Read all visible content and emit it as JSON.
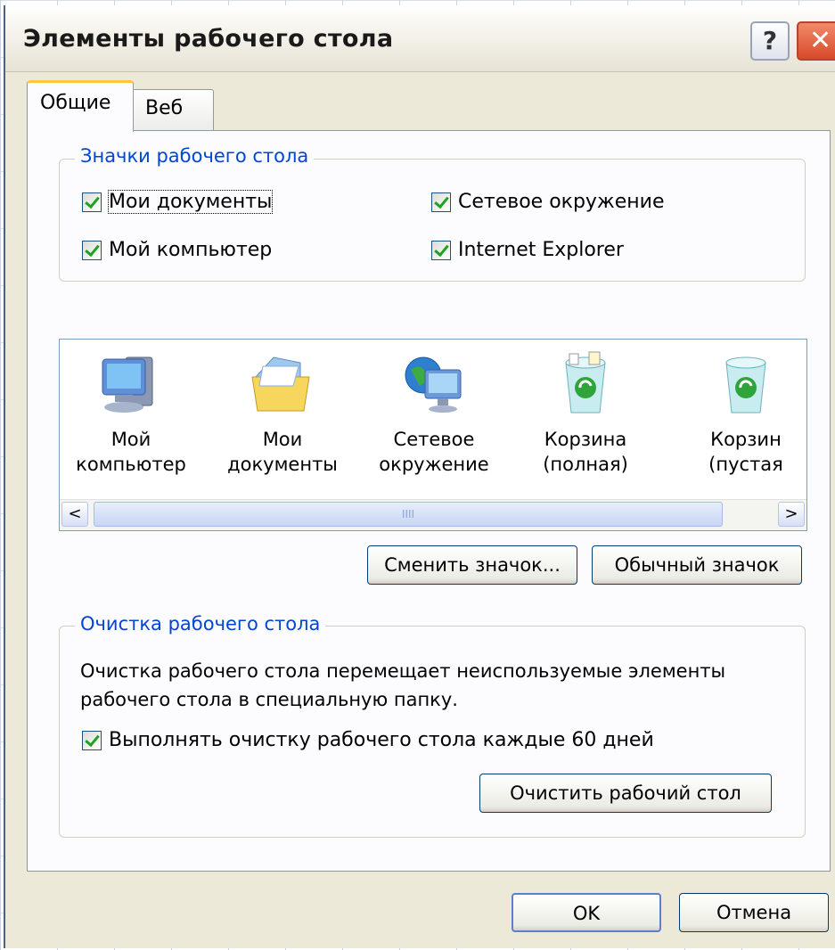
{
  "window": {
    "title": "Элементы рабочего стола",
    "help_label": "?",
    "close_label": "✕"
  },
  "tabs": [
    {
      "label": "Общие",
      "active": true
    },
    {
      "label": "Веб",
      "active": false
    }
  ],
  "desktop_icons_group": {
    "title": "Значки рабочего стола",
    "checkboxes": [
      {
        "label": "Мои документы",
        "checked": true
      },
      {
        "label": "Сетевое окружение",
        "checked": true
      },
      {
        "label": "Мой компьютер",
        "checked": true
      },
      {
        "label": "Internet Explorer",
        "checked": true
      }
    ]
  },
  "icon_list": {
    "items": [
      {
        "label": "Мой\nкомпьютер",
        "icon": "my-computer-icon"
      },
      {
        "label": "Мои\nдокументы",
        "icon": "my-documents-icon"
      },
      {
        "label": "Сетевое\nокружение",
        "icon": "network-places-icon"
      },
      {
        "label": "Корзина\n(полная)",
        "icon": "recycle-bin-full-icon"
      },
      {
        "label": "Корзин\n(пустая",
        "icon": "recycle-bin-empty-icon"
      }
    ],
    "scroll_left": "<",
    "scroll_right": ">",
    "scroll_grip": "IIII"
  },
  "icon_buttons": {
    "change_icon": "Сменить значок...",
    "default_icon": "Обычный значок"
  },
  "cleanup_group": {
    "title": "Очистка рабочего стола",
    "description_line1": "Очистка рабочего стола перемещает неиспользуемые элементы",
    "description_line2": "рабочего стола в специальную папку.",
    "checkbox_label": "Выполнять очистку рабочего стола каждые 60 дней",
    "checkbox_checked": true,
    "clean_button": "Очистить рабочий стол"
  },
  "footer": {
    "ok": "OK",
    "cancel": "Отмена"
  },
  "colors": {
    "dialog_bg": "#ece9d8",
    "group_title": "#0046d5",
    "check_mark": "#21a121",
    "close_button": "#d8492a"
  }
}
